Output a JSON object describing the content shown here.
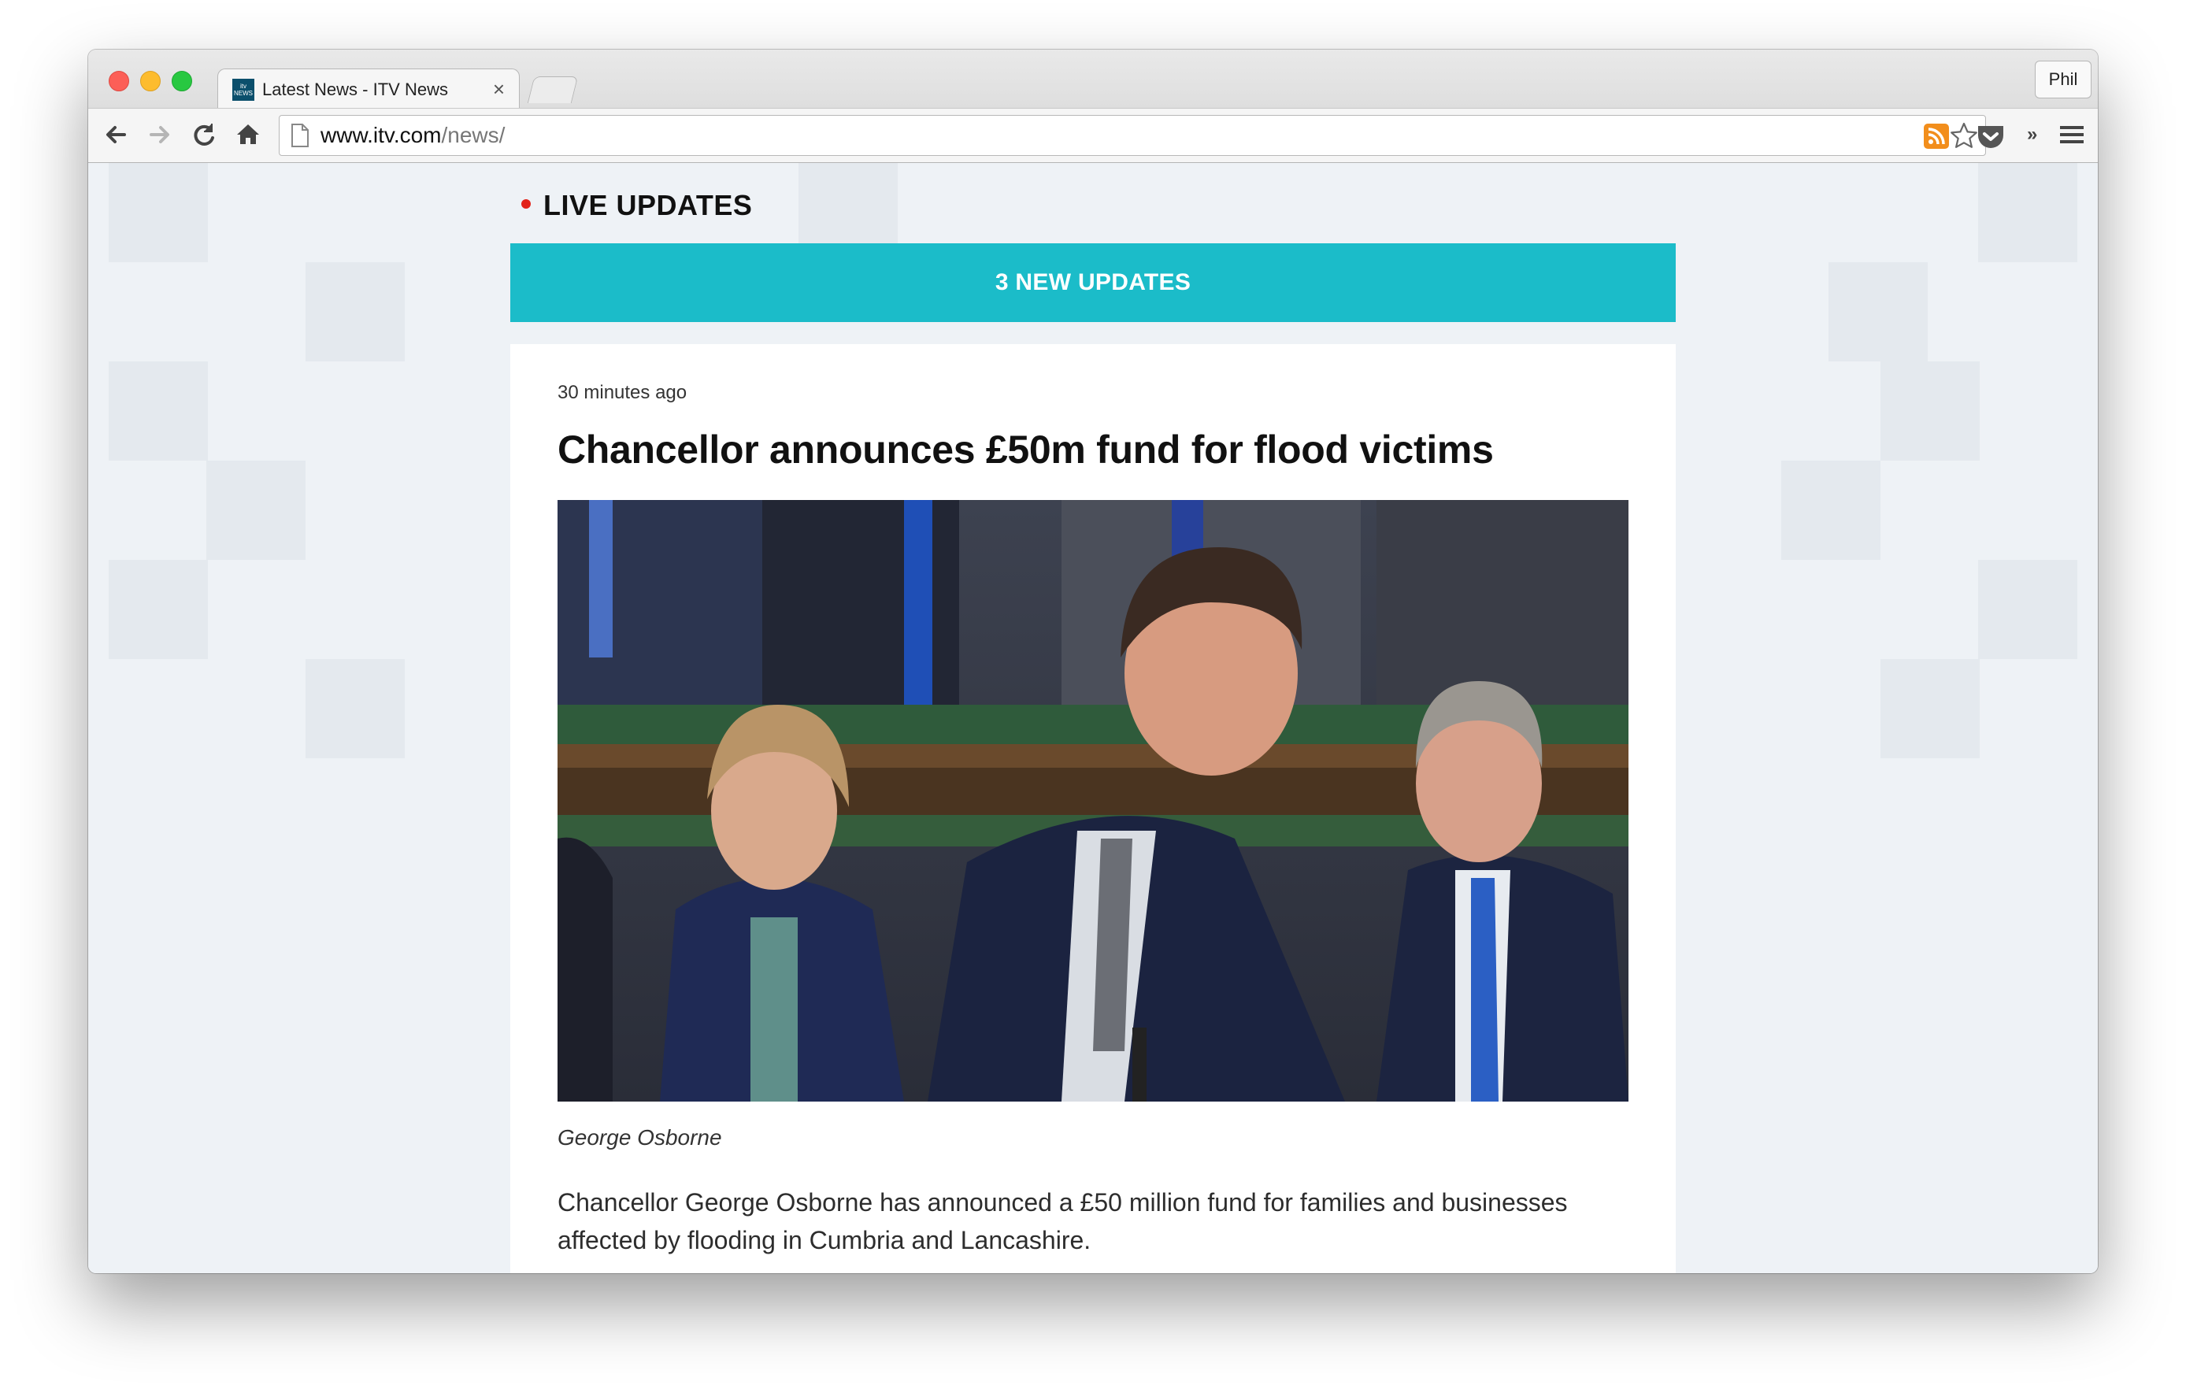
{
  "browser": {
    "tab": {
      "title": "Latest News - ITV News",
      "favicon_text": "itv NEWS",
      "close_glyph": "×"
    },
    "profile_name": "Phil",
    "address_bar": {
      "host": "www.itv.com",
      "path": "/news/"
    },
    "toolbar_icons": [
      "back-icon",
      "forward-icon",
      "reload-icon",
      "home-icon",
      "rss-icon",
      "bookmark-star-icon",
      "pocket-icon",
      "extensions-overflow-icon",
      "menu-icon"
    ],
    "overflow_glyph": "»"
  },
  "page": {
    "live_label": "LIVE UPDATES",
    "updates_button_label": "3 NEW UPDATES",
    "article": {
      "timestamp": "30 minutes ago",
      "headline": "Chancellor announces £50m fund for flood victims",
      "image_caption": "George Osborne",
      "body": "Chancellor George Osborne has announced a £50 million fund for families and businesses affected by flooding in Cumbria and Lancashire."
    }
  },
  "colors": {
    "accent_teal": "#1bbcc9",
    "live_dot_red": "#e2231a",
    "page_background": "#eef2f6",
    "rss_orange": "#f28e1c"
  }
}
